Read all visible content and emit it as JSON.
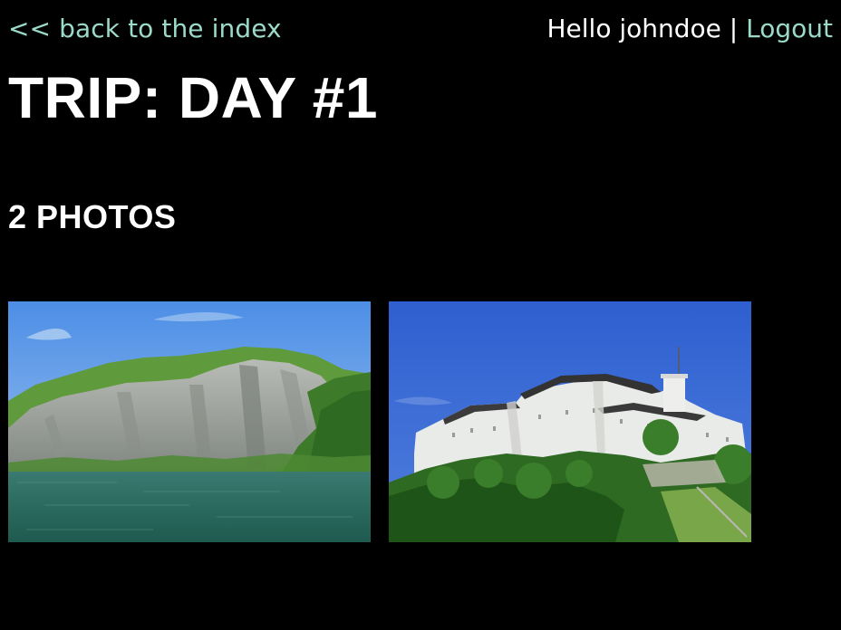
{
  "nav": {
    "back_label": "<< back to the index"
  },
  "user": {
    "greeting": "Hello johndoe",
    "separator": " | ",
    "logout_label": "Logout"
  },
  "page": {
    "title": "TRIP: DAY #1",
    "photo_count_label": "2 PHOTOS"
  },
  "colors": {
    "background": "#000000",
    "link": "#9bd9c9",
    "text": "#ffffff"
  },
  "photos": [
    {
      "subject": "lake-cliff-photo"
    },
    {
      "subject": "hilltop-fortress-photo"
    }
  ]
}
